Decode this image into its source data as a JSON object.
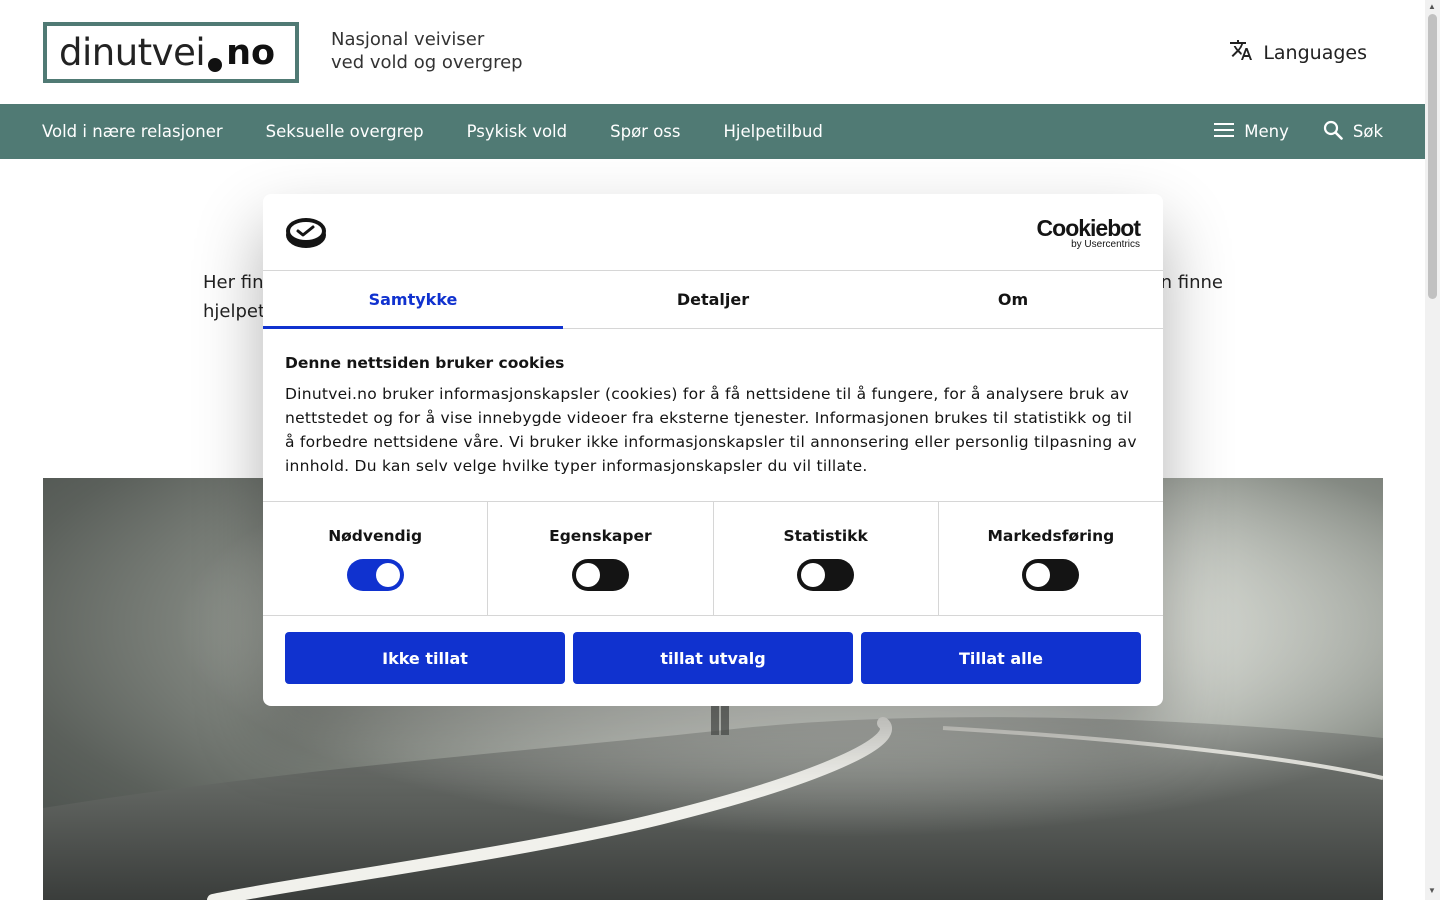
{
  "site": {
    "logo_text": "dinutvei",
    "logo_tld": "no",
    "tagline_line1": "Nasjonal veiviser",
    "tagline_line2": "ved vold og overgrep",
    "languages_label": "Languages"
  },
  "nav": {
    "items": [
      {
        "label": "Vold i nære relasjoner"
      },
      {
        "label": "Seksuelle overgrep"
      },
      {
        "label": "Psykisk vold"
      },
      {
        "label": "Spør oss"
      },
      {
        "label": "Hjelpetilbud"
      }
    ],
    "menu_label": "Meny",
    "search_label": "Søk"
  },
  "intro": {
    "visible_line1_left": "Her finn",
    "visible_line1_right": "n finne",
    "visible_line2_left": "hjelpet"
  },
  "cookie_dialog": {
    "brand_name": "Cookiebot",
    "brand_sub": "by Usercentrics",
    "tabs": [
      {
        "label": "Samtykke",
        "active": true
      },
      {
        "label": "Detaljer",
        "active": false
      },
      {
        "label": "Om",
        "active": false
      }
    ],
    "title": "Denne nettsiden bruker cookies",
    "body": "Dinutvei.no bruker informasjonskapsler (cookies) for å få nettsidene til å fungere, for å analysere bruk av nettstedet og for å vise innebygde videoer fra eksterne tjenester. Informasjonen brukes til statistikk og til å forbedre nettsidene våre. Vi bruker ikke informasjonskapsler til annonsering eller personlig tilpasning av innhold. Du kan selv velge hvilke typer informasjonskapsler du vil tillate.",
    "toggles": [
      {
        "label": "Nødvendig",
        "on": true
      },
      {
        "label": "Egenskaper",
        "on": false
      },
      {
        "label": "Statistikk",
        "on": false
      },
      {
        "label": "Markedsføring",
        "on": false
      }
    ],
    "buttons": {
      "deny": "Ikke tillat",
      "allow_selection": "tillat utvalg",
      "allow_all": "Tillat alle"
    }
  },
  "colors": {
    "brand_teal": "#507a74",
    "cookiebot_blue": "#1032cf",
    "toggle_off": "#141414"
  }
}
